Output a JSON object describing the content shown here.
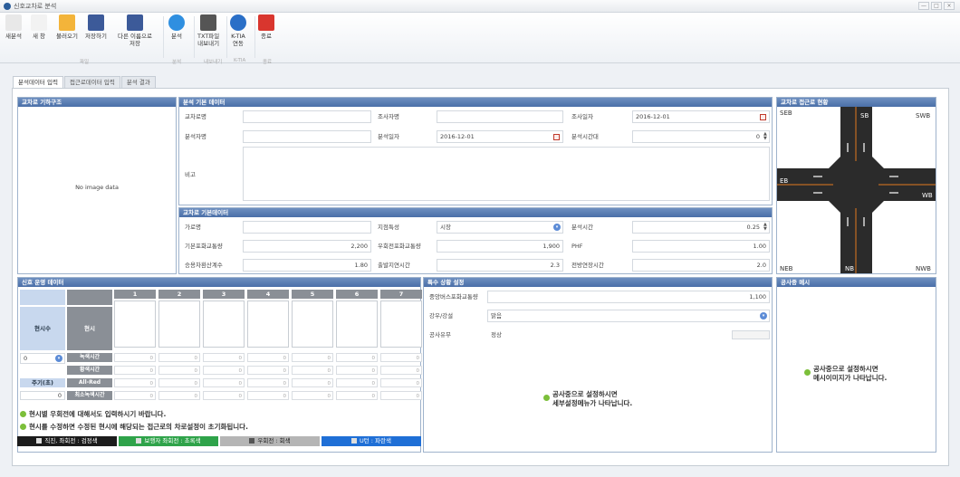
{
  "window": {
    "title": "신호교차로 분석",
    "controls": [
      "—",
      "□",
      "×"
    ]
  },
  "ribbon": {
    "buttons": [
      {
        "id": "new",
        "label": "새분석",
        "icon": "new-doc-icon",
        "color": "#e8e8e8"
      },
      {
        "id": "new2",
        "label": "새 창",
        "icon": "new-window-icon",
        "color": "#f2f2f2"
      },
      {
        "id": "open",
        "label": "불러오기",
        "icon": "folder-icon",
        "color": "#f3b43a"
      },
      {
        "id": "save",
        "label": "저장하기",
        "icon": "floppy-icon",
        "color": "#3c5a99"
      },
      {
        "id": "saveas",
        "label": "다른 이름으로\n저장",
        "icon": "floppy-saveas-icon",
        "color": "#3c5a99"
      },
      {
        "id": "analyze",
        "label": "분석",
        "icon": "play-icon",
        "color": "#2f8fe0"
      },
      {
        "id": "export",
        "label": "TXT파일\n내보내기",
        "icon": "export-txt-icon",
        "color": "#555"
      },
      {
        "id": "ktia",
        "label": "K-TIA\n연동",
        "icon": "globe-icon",
        "color": "#2a6fc7"
      },
      {
        "id": "exit",
        "label": "종료",
        "icon": "close-red-icon",
        "color": "#d9362e"
      }
    ],
    "groups": [
      "파일",
      "분석",
      "내보내기",
      "K-TIA",
      "종료"
    ]
  },
  "tabs": [
    {
      "label": "분석데이터 입력",
      "active": true
    },
    {
      "label": "접근로데이터 입력",
      "active": false
    },
    {
      "label": "분석 결과",
      "active": false
    }
  ],
  "geometry_panel": {
    "title": "교차로 기하구조",
    "empty_text": "No image data"
  },
  "basic_panel": {
    "title": "분석 기본 데이터",
    "labels": {
      "intersection": "교차로명",
      "surveyor": "조사자명",
      "survey_date_label": "조사일자",
      "analyst": "분석자명",
      "analysis_date_label": "분석일자",
      "analysis_interval": "분석시간대",
      "remarks": "비고"
    },
    "values": {
      "intersection": "",
      "surveyor": "",
      "survey_date": "2016-12-01",
      "analyst": "",
      "analysis_date": "2016-12-01",
      "analysis_interval": "0",
      "remarks": ""
    }
  },
  "traffic_panel": {
    "title": "교차로 기본데이터",
    "labels": {
      "road_name": "가로명",
      "area_type": "지점특성",
      "analysis_time": "분석시간",
      "base_sat_flow": "기본포화교통량",
      "right_turn_sat_flow": "우회전포화교통량",
      "phf": "PHF",
      "bus_equiv": "승용차환산계수",
      "start_loss": "출발지연시간",
      "clearance": "전방연장시간"
    },
    "values": {
      "road_name": "",
      "area_type": "시장",
      "analysis_time": "0.25",
      "base_sat_flow": "2,200",
      "right_turn_sat_flow": "1,900",
      "phf": "1.00",
      "bus_equiv": "1.80",
      "start_loss": "2.3",
      "clearance": "2.0"
    }
  },
  "approach_panel": {
    "title": "교차로 접근로 현황",
    "labels": {
      "sb": "SB",
      "swb": "SWB",
      "seb": "SEB",
      "eb": "EB",
      "wb": "WB",
      "neb": "NEB",
      "nb": "NB",
      "nwb": "NWB"
    }
  },
  "signal_panel": {
    "title": "신호 운영 데이터",
    "phase_count_label": "현시수",
    "phase_label": "현시",
    "columns": [
      "1",
      "2",
      "3",
      "4",
      "5",
      "6",
      "7"
    ],
    "rows": [
      "녹색시간",
      "황색시간",
      "All-Red",
      "최소녹색시간"
    ],
    "row_values": [
      [
        "0",
        "0",
        "0",
        "0",
        "0",
        "0",
        "0"
      ],
      [
        "0",
        "0",
        "0",
        "0",
        "0",
        "0",
        "0"
      ],
      [
        "0",
        "0",
        "0",
        "0",
        "0",
        "0",
        "0"
      ],
      [
        "0",
        "0",
        "0",
        "0",
        "0",
        "0",
        "0"
      ]
    ],
    "phase_count_value": "0",
    "cycle_label": "주기(초)",
    "cycle_value": "0",
    "notes": [
      "현시별 우회전에 대해서도 입력하시기 바랍니다.",
      "현시를 수정하면 수정된 현시에 해당되는 접근로의 차로설정이 초기화됩니다."
    ],
    "legend": [
      {
        "label": "직진, 좌회전 : 검정색",
        "color": "#1c1c1c"
      },
      {
        "label": "보행자 좌회전 : 초록색",
        "color": "#2fa34a"
      },
      {
        "label": "우회전 : 회색",
        "color": "#b5b5b5"
      },
      {
        "label": "U턴 : 파란색",
        "color": "#1f6fd6"
      }
    ]
  },
  "special_panel": {
    "title": "특수 상황 설정",
    "labels": {
      "bus_volume": "중앙버스포화교통량",
      "weather": "강우/강설",
      "construction": "공사유무"
    },
    "values": {
      "bus_volume": "1,100",
      "weather": "맑음",
      "construction": "정상"
    },
    "message": "공사중으로 설정하시면\n세부설정메뉴가 나타납니다."
  },
  "construction_panel": {
    "title": "공사중 메시",
    "message": "공사중으로 설정하시면\n메시이미지가 나타납니다."
  }
}
